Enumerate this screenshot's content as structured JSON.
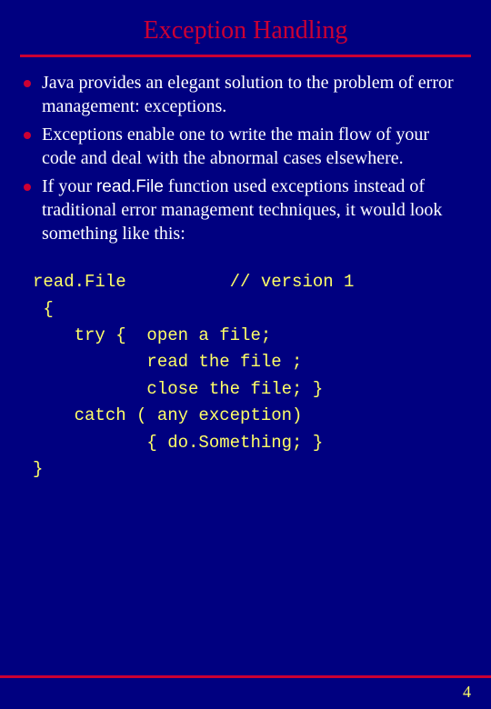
{
  "title": "Exception Handling",
  "bullets": [
    "Java provides an elegant solution to the problem of error management: exceptions.",
    "Exceptions enable one to write the main flow of your code and deal with the abnormal cases elsewhere."
  ],
  "bullet3_pre": "If your ",
  "bullet3_fn": "read.File",
  "bullet3_post": " function used exceptions instead of traditional error management techniques, it would look something like this:",
  "code": {
    "l1": "read.File          // version 1",
    "l2": " {",
    "l3": "    try {  open a file;",
    "l4": "           read the file ;",
    "l5": "           close the file; }",
    "l6": "    catch ( any exception)",
    "l7": "           { do.Something; }",
    "l8": "}"
  },
  "page": "4"
}
